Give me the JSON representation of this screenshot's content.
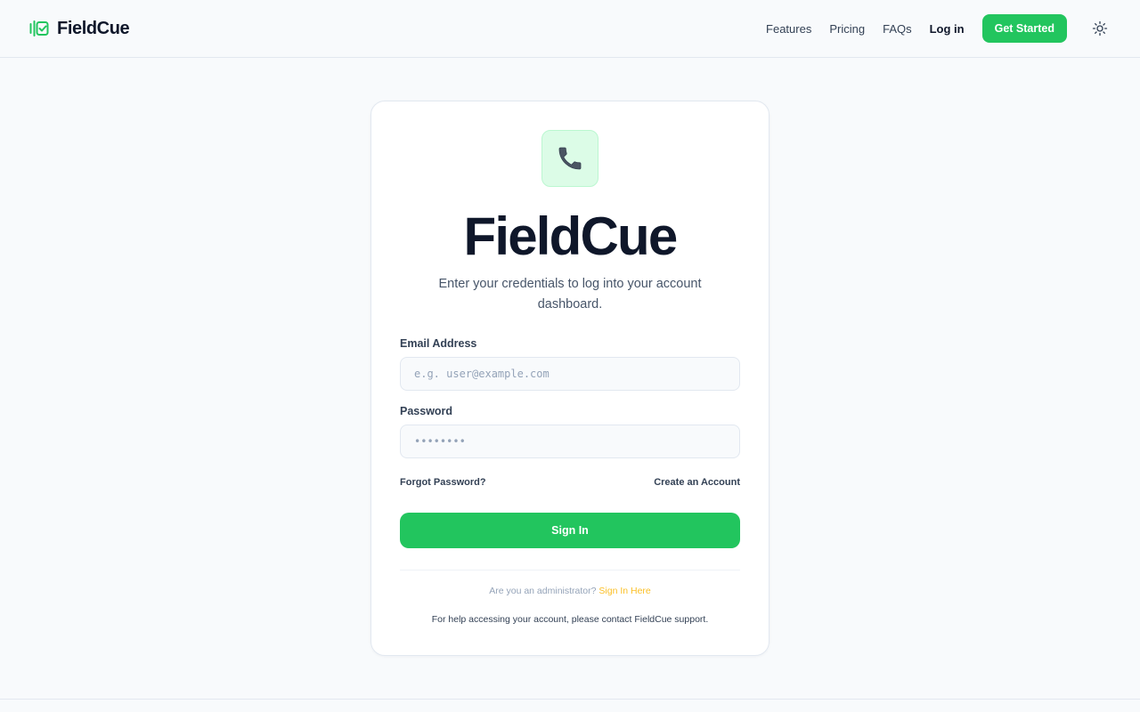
{
  "header": {
    "brand_name": "FieldCue",
    "brand_icon": "fieldcue-logo-icon",
    "nav": [
      {
        "label": "Features"
      },
      {
        "label": "Pricing"
      },
      {
        "label": "FAQs"
      },
      {
        "label": "Log in"
      }
    ],
    "cta_label": "Get Started",
    "theme_icon": "sun-icon"
  },
  "login": {
    "app_icon": "telephone-icon",
    "title": "FieldCue",
    "subtitle": "Enter your credentials to log into your account dashboard.",
    "email": {
      "label": "Email Address",
      "placeholder": "e.g. user@example.com",
      "value": ""
    },
    "password": {
      "label": "Password",
      "placeholder": "••••••••",
      "value": ""
    },
    "forgot_label": "Forgot Password?",
    "create_label": "Create an Account",
    "submit_label": "Sign In",
    "admin_prompt": "Are you an administrator?",
    "admin_link": "Sign In Here",
    "help_text": "For help accessing your account, please contact FieldCue support."
  },
  "colors": {
    "accent": "#22c55e",
    "admin_link": "#fbbf24",
    "text_dark": "#0f172a",
    "background": "#f8fafc"
  }
}
